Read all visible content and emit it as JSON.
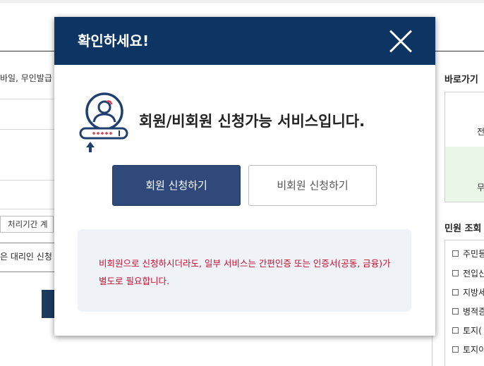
{
  "background": {
    "left_texts": [
      "바일, 무인발급",
      "처리기간 계",
      "은 대리인 신청"
    ],
    "side_title_1": "바로가기",
    "side_box_texts": [
      "전",
      "무"
    ],
    "side_title_2": "민원 조회",
    "side_items": [
      "주민등",
      "전입신",
      "지방세",
      "병적증",
      "토지(",
      "토지이"
    ]
  },
  "modal": {
    "title": "확인하세요!",
    "close_label": "",
    "message": "회원/비회원 신청가능 서비스입니다.",
    "member_button": "회원 신청하기",
    "guest_button": "비회원 신청하기",
    "notice": "비회원으로 신청하시더라도, 일부 서비스는 간편인증 또는 인증서(공동, 금융)가 별도로 필요합니다."
  },
  "colors": {
    "header": "#0c3563",
    "member_button": "#2f4a7a",
    "notice_text": "#c4112f",
    "notice_bg": "#eff3f8",
    "icon": "#1f3f6e",
    "icon_accent": "#e03a4b"
  },
  "icons": {
    "close": "close-icon",
    "modal": "user-login-icon"
  }
}
